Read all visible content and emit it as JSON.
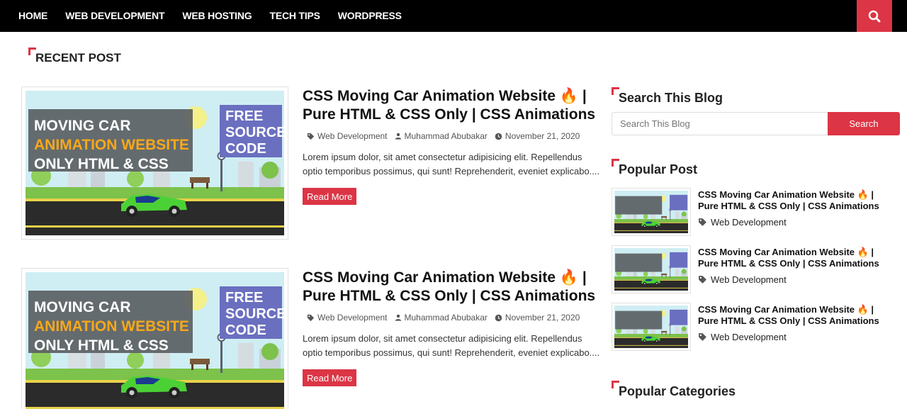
{
  "nav": {
    "items": [
      "HOME",
      "WEB DEVELOPMENT",
      "WEB HOSTING",
      "TECH TIPS",
      "WORDPRESS"
    ]
  },
  "recent": {
    "heading": "RECENT POST"
  },
  "posts": [
    {
      "title": "CSS Moving Car Animation Website 🔥 | Pure HTML & CSS Only | CSS Animations",
      "category": "Web Development",
      "author": "Muhammad Abubakar",
      "date": "November 21, 2020",
      "excerpt": "Lorem ipsum dolor, sit amet consectetur adipisicing elit. Repellendus optio temporibus possimus, qui sunt! Reprehenderit, eveniet explicabo....",
      "read_more": "Read More",
      "thumb": {
        "line1": "MOVING CAR",
        "line2": "ANIMATION WEBSITE",
        "line3": "ONLY HTML & CSS",
        "badge1": "FREE",
        "badge2": "SOURCE",
        "badge3": "CODE"
      }
    },
    {
      "title": "CSS Moving Car Animation Website 🔥 | Pure HTML & CSS Only | CSS Animations",
      "category": "Web Development",
      "author": "Muhammad Abubakar",
      "date": "November 21, 2020",
      "excerpt": "Lorem ipsum dolor, sit amet consectetur adipisicing elit. Repellendus optio temporibus possimus, qui sunt! Reprehenderit, eveniet explicabo....",
      "read_more": "Read More",
      "thumb": {
        "line1": "MOVING CAR",
        "line2": "ANIMATION WEBSITE",
        "line3": "ONLY HTML & CSS",
        "badge1": "FREE",
        "badge2": "SOURCE",
        "badge3": "CODE"
      }
    }
  ],
  "sidebar": {
    "search_heading": "Search This Blog",
    "search_placeholder": "Search This Blog",
    "search_button": "Search",
    "popular_heading": "Popular Post",
    "popular": [
      {
        "title": "CSS Moving Car Animation Website 🔥 | Pure HTML & CSS Only | CSS Animations",
        "category": "Web Development"
      },
      {
        "title": "CSS Moving Car Animation Website 🔥 | Pure HTML & CSS Only | CSS Animations",
        "category": "Web Development"
      },
      {
        "title": "CSS Moving Car Animation Website 🔥 | Pure HTML & CSS Only | CSS Animations",
        "category": "Web Development"
      }
    ],
    "categories_heading": "Popular Categories"
  },
  "colors": {
    "accent": "#dc3545",
    "nav_bg": "#000000"
  }
}
